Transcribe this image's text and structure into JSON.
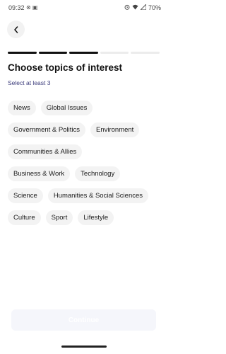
{
  "status_bar": {
    "time": "09:32",
    "left_icons": "⊗ ▣",
    "battery": "70%"
  },
  "header": {
    "back_icon": "chevron-left-icon",
    "progress": {
      "total_steps": 5,
      "completed_steps": 3
    }
  },
  "content": {
    "title": "Choose topics of interest",
    "subtitle": "Select at least 3"
  },
  "topics": [
    [
      "News",
      "Global Issues"
    ],
    [
      "Government & Politics",
      "Environment"
    ],
    [
      "Communities & Allies"
    ],
    [
      "Business & Work",
      "Technology"
    ],
    [
      "Science",
      "Humanities & Social Sciences"
    ],
    [
      "Culture",
      "Sport",
      "Lifestyle"
    ]
  ],
  "footer": {
    "continue_label": "Continue"
  },
  "colors": {
    "accent": "#111111",
    "chip_bg": "#f3f3f3",
    "button_disabled": "#f5f6fb"
  }
}
